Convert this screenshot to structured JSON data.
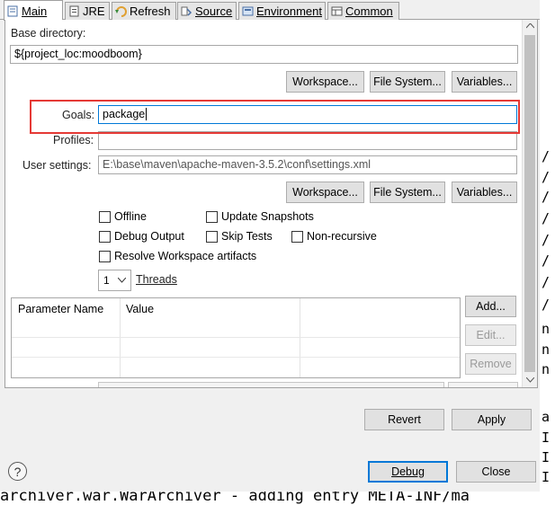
{
  "tabs": [
    {
      "label": "Main",
      "icon": "main-tab-icon",
      "active": true
    },
    {
      "label": "JRE",
      "icon": "jre-icon"
    },
    {
      "label": "Refresh",
      "icon": "refresh-icon"
    },
    {
      "label": "Source",
      "icon": "source-icon"
    },
    {
      "label": "Environment",
      "icon": "environment-icon"
    },
    {
      "label": "Common",
      "icon": "common-icon"
    }
  ],
  "base_directory": {
    "label": "Base directory:",
    "value": "${project_loc:moodboom}"
  },
  "buttons_row1": {
    "workspace": "Workspace...",
    "file_system": "File System...",
    "variables": "Variables..."
  },
  "goals": {
    "label": "Goals:",
    "value": "package"
  },
  "profiles": {
    "label": "Profiles:",
    "value": ""
  },
  "user_settings": {
    "label": "User settings:",
    "value": "E:\\base\\maven\\apache-maven-3.5.2\\conf\\settings.xml"
  },
  "buttons_row2": {
    "workspace": "Workspace...",
    "file_system": "File System...",
    "variables": "Variables..."
  },
  "options": {
    "offline": "Offline",
    "update_snapshots": "Update Snapshots",
    "debug_output": "Debug Output",
    "skip_tests": "Skip Tests",
    "non_recursive": "Non-recursive",
    "resolve_workspace": "Resolve Workspace artifacts"
  },
  "threads": {
    "value": "1",
    "label": "Threads"
  },
  "param_table": {
    "headers": [
      "Parameter Name",
      "Value"
    ],
    "buttons": {
      "add": "Add...",
      "edit": "Edit...",
      "remove": "Remove"
    }
  },
  "footer": {
    "revert": "Revert",
    "apply": "Apply",
    "debug": "Debug",
    "close": "Close",
    "help": "?"
  },
  "console": {
    "bottom_line": "archiver.war.WarArchiver - adding entry META-INF/ma",
    "right_chars": [
      "/",
      "/",
      "/",
      "/",
      "/",
      "/",
      "/",
      "/",
      "n",
      "n",
      "n",
      "a",
      "I",
      "I",
      "I"
    ]
  },
  "colors": {
    "highlight": "#e53935",
    "accent": "#0078d7"
  }
}
